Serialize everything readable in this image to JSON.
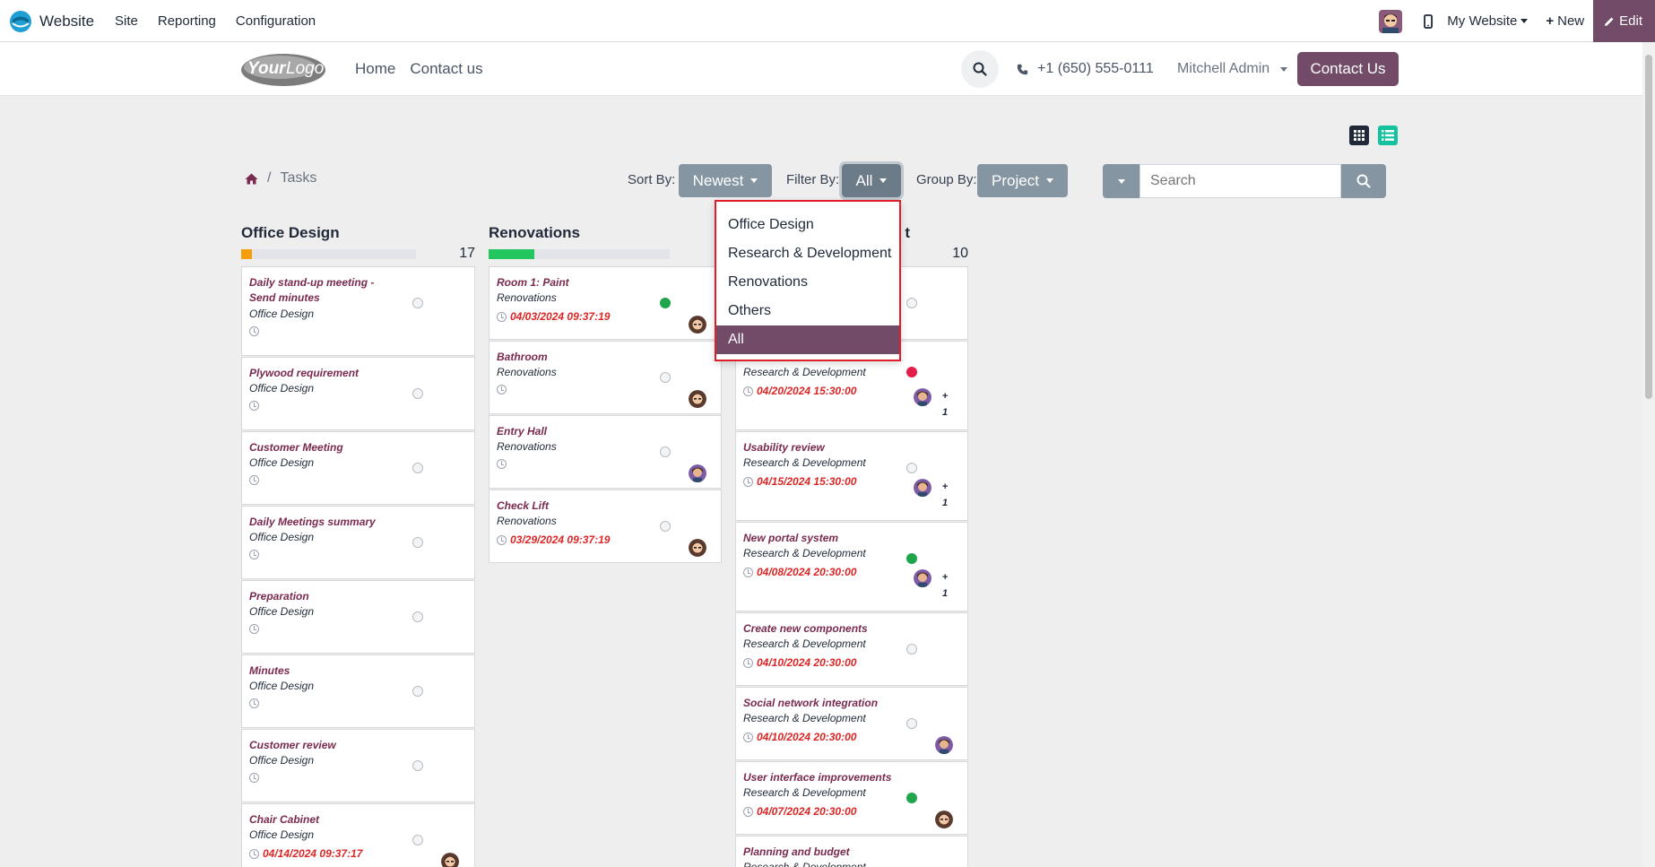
{
  "admin_bar": {
    "brand": "Website",
    "menu": [
      "Site",
      "Reporting",
      "Configuration"
    ],
    "my_website": "My Website",
    "new_label": "New",
    "edit_label": "Edit"
  },
  "site_header": {
    "nav": [
      "Home",
      "Contact us"
    ],
    "phone": "+1 (650) 555-0111",
    "user": "Mitchell Admin",
    "contact_button": "Contact Us"
  },
  "breadcrumb": {
    "separator": "/",
    "current": "Tasks"
  },
  "controls": {
    "sort_label": "Sort By:",
    "sort_value": "Newest",
    "filter_label": "Filter By:",
    "filter_value": "All",
    "group_label": "Group By:",
    "group_value": "Project",
    "search_placeholder": "Search"
  },
  "filter_dropdown": {
    "options": [
      "Office Design",
      "Research & Development",
      "Renovations",
      "Others",
      "All"
    ],
    "selected_index": 4
  },
  "colors": {
    "brand": "#714b67",
    "progress_office": "#f59e0b",
    "progress_renovations": "#22c55e",
    "deadline": "#dc2626"
  },
  "columns": [
    {
      "title": "Office Design",
      "count": "17",
      "progress": 0.06,
      "cards": [
        {
          "title": "Daily stand-up meeting - Send minutes",
          "project": "Office Design",
          "date": "",
          "state": "normal",
          "avatar": ""
        },
        {
          "title": "Plywood requirement",
          "project": "Office Design",
          "date": "",
          "state": "normal",
          "avatar": ""
        },
        {
          "title": "Customer Meeting",
          "project": "Office Design",
          "date": "",
          "state": "normal",
          "avatar": ""
        },
        {
          "title": "Daily Meetings summary",
          "project": "Office Design",
          "date": "",
          "state": "normal",
          "avatar": ""
        },
        {
          "title": "Preparation",
          "project": "Office Design",
          "date": "",
          "state": "normal",
          "avatar": ""
        },
        {
          "title": "Minutes",
          "project": "Office Design",
          "date": "",
          "state": "normal",
          "avatar": ""
        },
        {
          "title": "Customer review",
          "project": "Office Design",
          "date": "",
          "state": "normal",
          "avatar": ""
        },
        {
          "title": "Chair Cabinet",
          "project": "Office Design",
          "date": "04/14/2024 09:37:17",
          "state": "normal",
          "avatar": "man"
        }
      ]
    },
    {
      "title": "Renovations",
      "count": "",
      "progress": 0.25,
      "cards": [
        {
          "title": "Room 1: Paint",
          "project": "Renovations",
          "date": "04/03/2024 09:37:19",
          "state": "done",
          "avatar": "man"
        },
        {
          "title": "Bathroom",
          "project": "Renovations",
          "date": "",
          "state": "normal",
          "avatar": "man"
        },
        {
          "title": "Entry Hall",
          "project": "Renovations",
          "date": "",
          "state": "normal",
          "avatar": "woman"
        },
        {
          "title": "Check Lift",
          "project": "Renovations",
          "date": "03/29/2024 09:37:19",
          "state": "normal",
          "avatar": "man"
        }
      ]
    },
    {
      "title_suffix": "t",
      "count": "10",
      "cards": [
        {
          "title": "",
          "project": "",
          "date": "",
          "state": "normal",
          "avatar": ""
        },
        {
          "title": "",
          "project": "Research & Development",
          "date": "04/20/2024 15:30:00",
          "state": "blocked",
          "avatar": "woman",
          "more": "+ 1"
        },
        {
          "title": "Usability review",
          "project": "Research & Development",
          "date": "04/15/2024 15:30:00",
          "state": "normal",
          "avatar": "woman",
          "more": "+ 1"
        },
        {
          "title": "New portal system",
          "project": "Research & Development",
          "date": "04/08/2024 20:30:00",
          "state": "done",
          "avatar": "woman",
          "more": "+ 1"
        },
        {
          "title": "Create new components",
          "project": "Research & Development",
          "date": "04/10/2024 20:30:00",
          "state": "normal",
          "avatar": ""
        },
        {
          "title": "Social network integration",
          "project": "Research & Development",
          "date": "04/10/2024 20:30:00",
          "state": "normal",
          "avatar": "woman"
        },
        {
          "title": "User interface improvements",
          "project": "Research & Development",
          "date": "04/07/2024 20:30:00",
          "state": "done",
          "avatar": "man"
        },
        {
          "title": "Planning and budget",
          "project": "Research & Development",
          "date": "",
          "state": "normal",
          "avatar": ""
        }
      ]
    }
  ]
}
